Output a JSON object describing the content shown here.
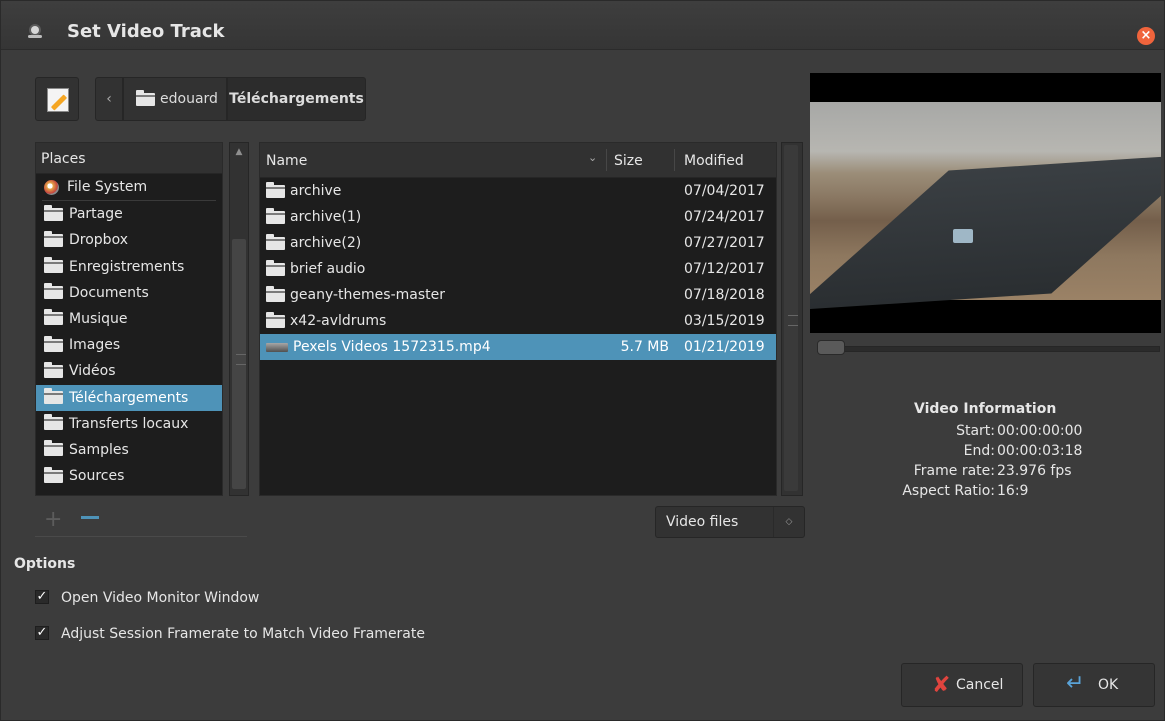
{
  "window": {
    "title": "Set Video Track"
  },
  "breadcrumbs": [
    "edouard",
    "Téléchargements"
  ],
  "places": {
    "header": "Places",
    "items": [
      {
        "label": "File System",
        "icon": "filesystem-icon"
      },
      {
        "label": "Partage",
        "icon": "folder-icon"
      },
      {
        "label": "Dropbox",
        "icon": "folder-icon"
      },
      {
        "label": "Enregistrements",
        "icon": "folder-icon"
      },
      {
        "label": "Documents",
        "icon": "folder-icon"
      },
      {
        "label": "Musique",
        "icon": "folder-icon"
      },
      {
        "label": "Images",
        "icon": "folder-icon"
      },
      {
        "label": "Vidéos",
        "icon": "folder-icon"
      },
      {
        "label": "Téléchargements",
        "icon": "folder-icon",
        "selected": true
      },
      {
        "label": "Transferts locaux",
        "icon": "folder-icon"
      },
      {
        "label": "Samples",
        "icon": "folder-icon"
      },
      {
        "label": "Sources",
        "icon": "folder-icon"
      }
    ]
  },
  "files": {
    "columns": {
      "name": "Name",
      "size": "Size",
      "modified": "Modified"
    },
    "rows": [
      {
        "name": "archive",
        "size": "",
        "modified": "07/04/2017",
        "type": "folder"
      },
      {
        "name": "archive(1)",
        "size": "",
        "modified": "07/24/2017",
        "type": "folder"
      },
      {
        "name": "archive(2)",
        "size": "",
        "modified": "07/27/2017",
        "type": "folder"
      },
      {
        "name": "brief audio",
        "size": "",
        "modified": "07/12/2017",
        "type": "folder"
      },
      {
        "name": "geany-themes-master",
        "size": "",
        "modified": "07/18/2018",
        "type": "folder"
      },
      {
        "name": "x42-avldrums",
        "size": "",
        "modified": "03/15/2019",
        "type": "folder"
      },
      {
        "name": "Pexels Videos 1572315.mp4",
        "size": "5.7 MB",
        "modified": "01/21/2019",
        "type": "video",
        "selected": true
      }
    ]
  },
  "filter": {
    "selected": "Video files"
  },
  "controls": {
    "add": "+"
  },
  "options": {
    "title": "Options",
    "items": [
      {
        "label": "Open Video Monitor Window",
        "checked": true
      },
      {
        "label": "Adjust Session Framerate to Match Video Framerate",
        "checked": true
      }
    ]
  },
  "video_info": {
    "title": "Video Information",
    "rows": [
      {
        "key": "Start:",
        "value": "00:00:00:00"
      },
      {
        "key": "End:",
        "value": "00:00:03:18"
      },
      {
        "key": "Frame rate:",
        "value": "23.976 fps"
      },
      {
        "key": "Aspect Ratio:",
        "value": "16:9"
      }
    ]
  },
  "buttons": {
    "cancel": "Cancel",
    "ok": "OK"
  },
  "colors": {
    "selection": "#4e93b8",
    "close": "#f0643c"
  }
}
